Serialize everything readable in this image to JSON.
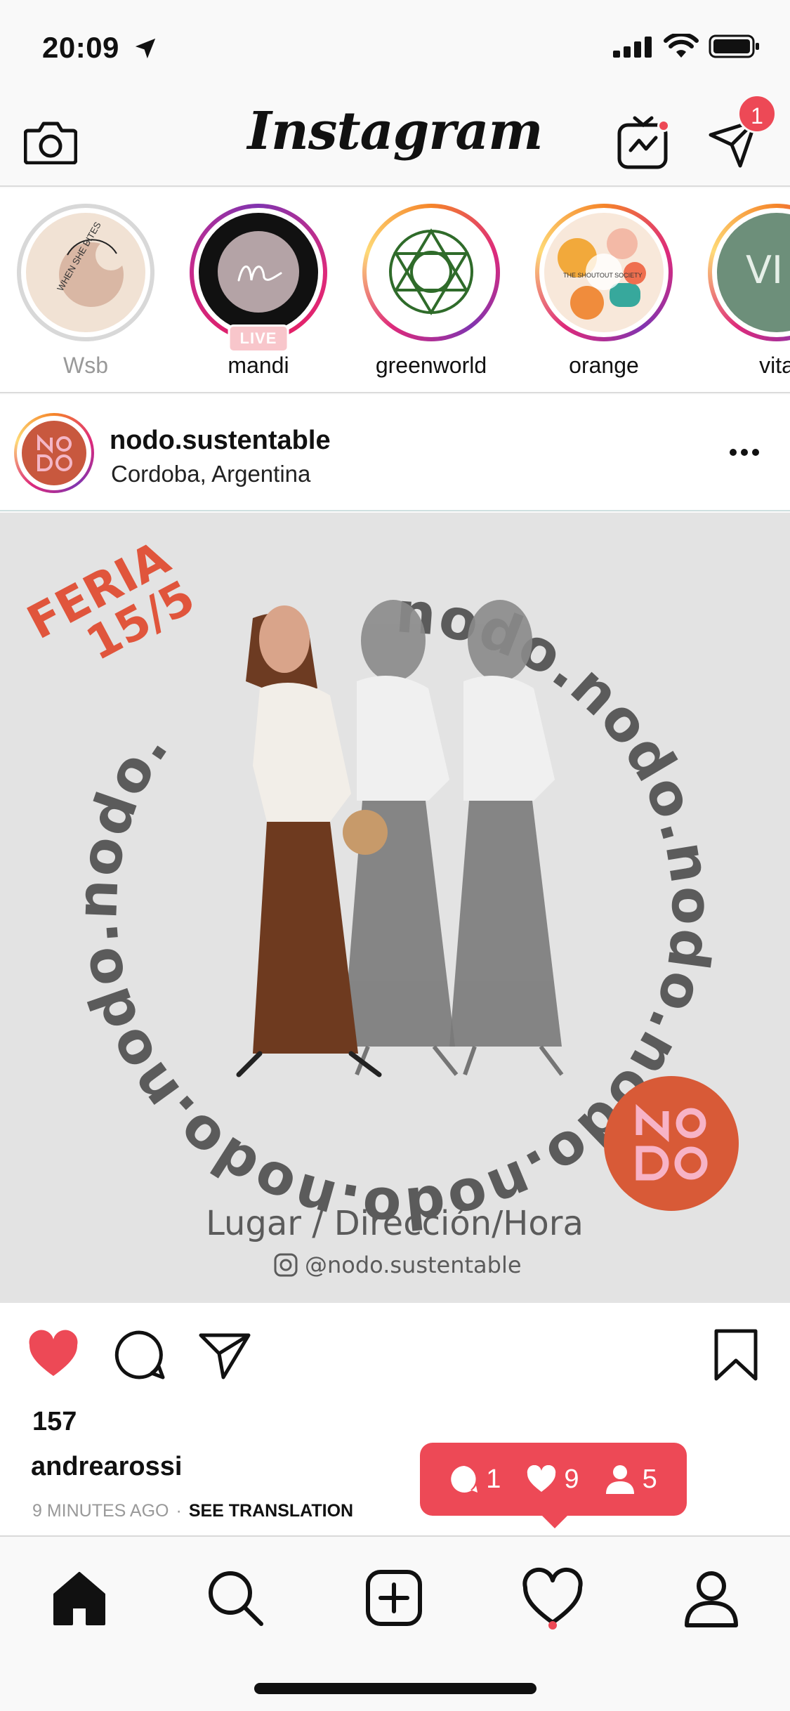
{
  "status_bar": {
    "time": "20:09"
  },
  "nav": {
    "logo": "Instagram",
    "camera_icon": "camera-icon",
    "igtv_icon": "igtv-icon",
    "direct_icon": "direct-message-icon",
    "direct_badge": "1"
  },
  "stories": [
    {
      "name": "Wsb",
      "seen": true,
      "pic_text": "WHEN SHE BITES"
    },
    {
      "name": "mandi",
      "live": true,
      "live_label": "LIVE"
    },
    {
      "name": "greenworld"
    },
    {
      "name": "orange",
      "pic_text": "THE SHOUTOUT SOCIETY"
    },
    {
      "name": "vita",
      "pic_text": "VI TA"
    }
  ],
  "post": {
    "username": "nodo.sustentable",
    "location": "Cordoba, Argentina",
    "image": {
      "feria_line1": "FERIA",
      "feria_line2": "15/5",
      "ring_text": "nodo.nodo.nodo.nodo.nodo.nodo.nodo.nodo.",
      "lugar": "Lugar / Dirección/Hora",
      "handle": "@nodo.sustentable",
      "badge_logo": "NO DO"
    },
    "likes": "157",
    "commenter": "andrearossi",
    "time_ago": "9 MINUTES AGO",
    "separator": "·",
    "see_translation": "SEE TRANSLATION"
  },
  "activity_popup": {
    "comments": "1",
    "likes": "9",
    "follows": "5"
  },
  "colors": {
    "accent": "#ed4956",
    "brand_orange": "#c8583e",
    "ring_gray": "#5b5b5b"
  }
}
